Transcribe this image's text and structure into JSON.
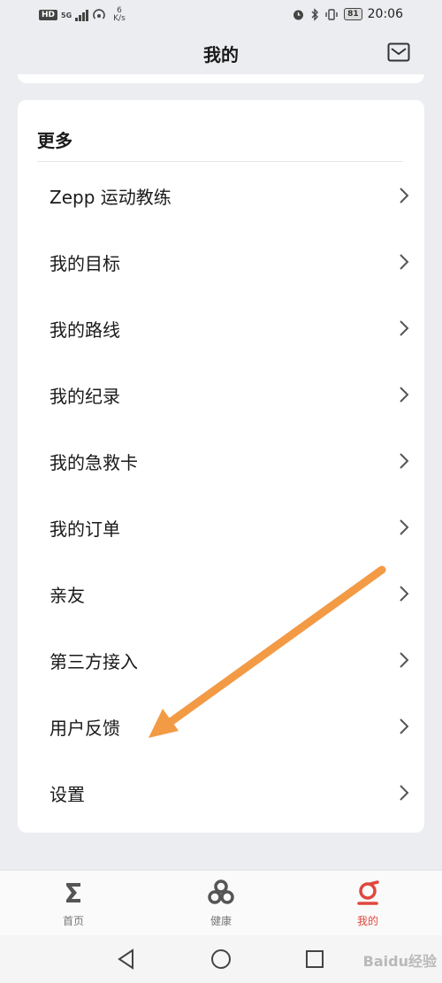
{
  "status_bar": {
    "hd": "HD",
    "network": "5G",
    "speed_value": "6",
    "speed_unit": "K/s",
    "battery": "81",
    "time": "20:06"
  },
  "header": {
    "title": "我的",
    "mail_icon": "mail-icon"
  },
  "card": {
    "title": "更多",
    "items": [
      {
        "label": "Zepp 运动教练"
      },
      {
        "label": "我的目标"
      },
      {
        "label": "我的路线"
      },
      {
        "label": "我的纪录"
      },
      {
        "label": "我的急救卡"
      },
      {
        "label": "我的订单"
      },
      {
        "label": "亲友"
      },
      {
        "label": "第三方接入"
      },
      {
        "label": "用户反馈"
      },
      {
        "label": "设置"
      }
    ]
  },
  "tabs": [
    {
      "label": "首页",
      "icon": "sigma-icon"
    },
    {
      "label": "健康",
      "icon": "health-icon"
    },
    {
      "label": "我的",
      "icon": "profile-icon",
      "active": true
    }
  ],
  "nav": {
    "back_icon": "back-icon",
    "home_icon": "home-icon",
    "recent_icon": "recent-apps-icon"
  },
  "colors": {
    "background": "#ecedf0",
    "card": "#ffffff",
    "accent": "#e0473d",
    "arrow": "#f39a45"
  },
  "watermark": "Baidu经验"
}
